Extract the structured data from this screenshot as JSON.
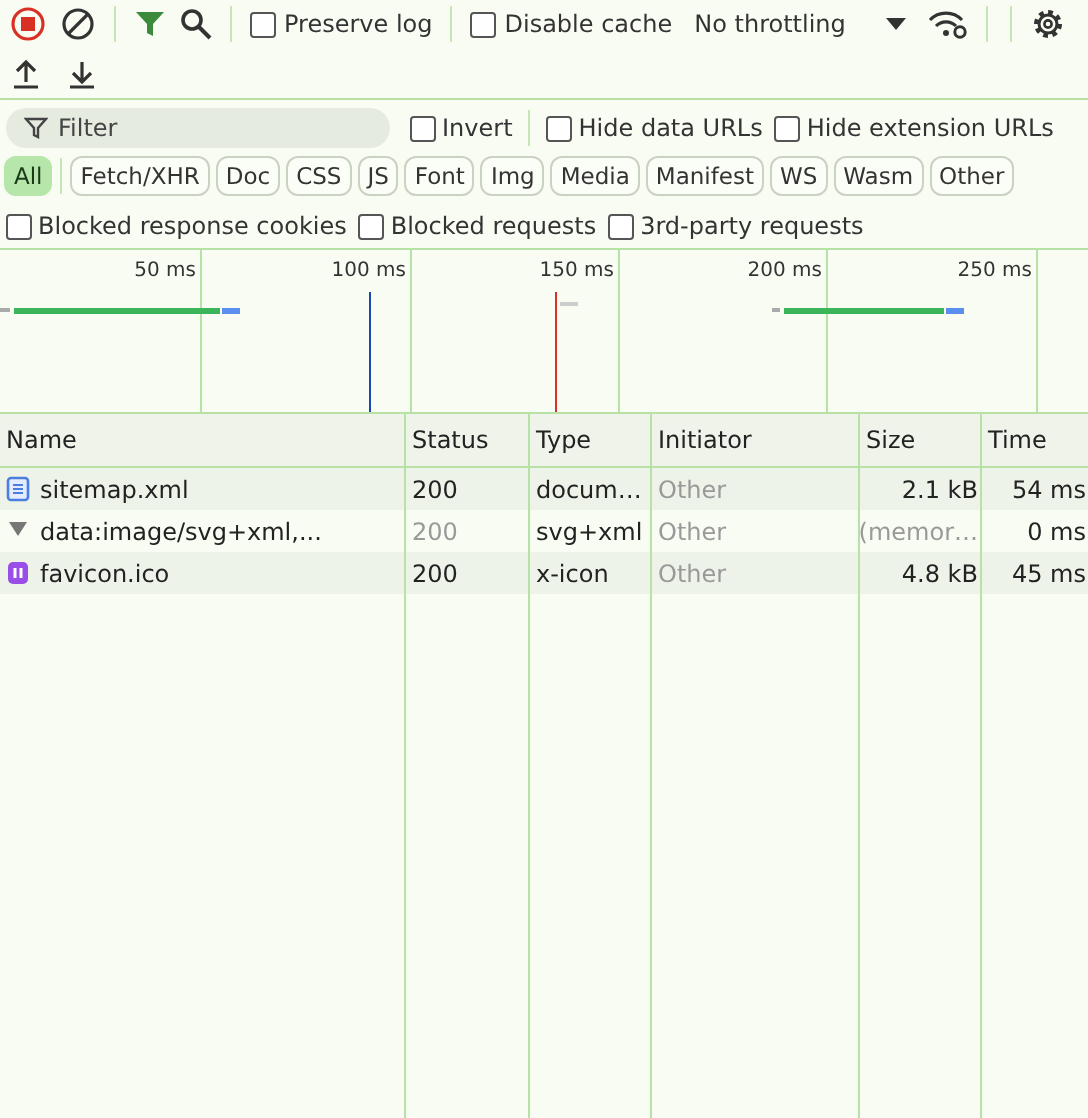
{
  "toolbar": {
    "recording": true,
    "filter_active": true,
    "preserve_log": {
      "label": "Preserve log",
      "checked": false
    },
    "disable_cache": {
      "label": "Disable cache",
      "checked": false
    },
    "throttling": "No throttling"
  },
  "filter_bar": {
    "placeholder": "Filter",
    "options": [
      {
        "label": "Invert",
        "checked": false
      },
      {
        "label": "Hide data URLs",
        "checked": false
      },
      {
        "label": "Hide extension URLs",
        "checked": false
      }
    ]
  },
  "type_filters": [
    {
      "label": "All",
      "selected": true
    },
    {
      "label": "Fetch/XHR",
      "selected": false
    },
    {
      "label": "Doc",
      "selected": false
    },
    {
      "label": "CSS",
      "selected": false
    },
    {
      "label": "JS",
      "selected": false
    },
    {
      "label": "Font",
      "selected": false
    },
    {
      "label": "Img",
      "selected": false
    },
    {
      "label": "Media",
      "selected": false
    },
    {
      "label": "Manifest",
      "selected": false
    },
    {
      "label": "WS",
      "selected": false
    },
    {
      "label": "Wasm",
      "selected": false
    },
    {
      "label": "Other",
      "selected": false
    }
  ],
  "blocked_options": [
    {
      "label": "Blocked response cookies",
      "checked": false
    },
    {
      "label": "Blocked requests",
      "checked": false
    },
    {
      "label": "3rd-party requests",
      "checked": false
    }
  ],
  "timeline": {
    "ticks": [
      "50 ms",
      "100 ms",
      "150 ms",
      "200 ms",
      "250 ms"
    ]
  },
  "table": {
    "columns": [
      "Name",
      "Status",
      "Type",
      "Initiator",
      "Size",
      "Time"
    ],
    "rows": [
      {
        "kind": "document",
        "name": "sitemap.xml",
        "status": "200",
        "type": "docum…",
        "initiator": "Other",
        "size": "2.1 kB",
        "time": "54 ms",
        "cached": false
      },
      {
        "kind": "data",
        "name": "data:image/svg+xml,...",
        "status": "200",
        "type": "svg+xml",
        "initiator": "Other",
        "size": "(memor…",
        "time": "0 ms",
        "cached": true
      },
      {
        "kind": "icon",
        "name": "favicon.ico",
        "status": "200",
        "type": "x-icon",
        "initiator": "Other",
        "size": "4.8 kB",
        "time": "45 ms",
        "cached": false
      }
    ]
  }
}
